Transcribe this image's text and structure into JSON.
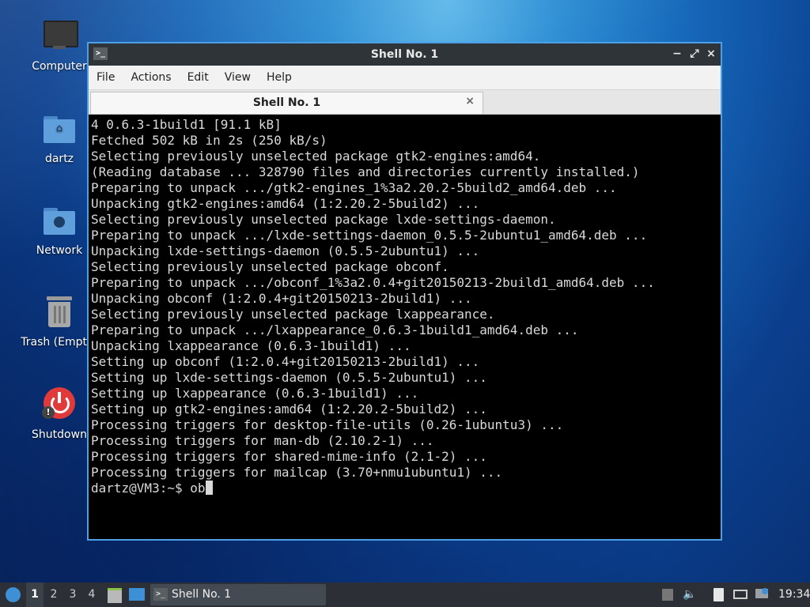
{
  "desktop": {
    "icons": [
      {
        "label": "Computer",
        "icon": "computer-icon"
      },
      {
        "label": "dartz",
        "icon": "home-folder-icon"
      },
      {
        "label": "Network",
        "icon": "network-folder-icon"
      },
      {
        "label": "Trash (Empty)",
        "icon": "trash-icon"
      },
      {
        "label": "Shutdown",
        "icon": "shutdown-icon"
      }
    ]
  },
  "window": {
    "title": "Shell No. 1",
    "menu": [
      "File",
      "Actions",
      "Edit",
      "View",
      "Help"
    ],
    "tab_label": "Shell No. 1",
    "tab_close": "×",
    "controls": {
      "minimize": "−",
      "maximize": "⤢",
      "close": "×"
    }
  },
  "terminal": {
    "lines": [
      "4 0.6.3-1build1 [91.1 kB]",
      "Fetched 502 kB in 2s (250 kB/s)",
      "Selecting previously unselected package gtk2-engines:amd64.",
      "(Reading database ... 328790 files and directories currently installed.)",
      "Preparing to unpack .../gtk2-engines_1%3a2.20.2-5build2_amd64.deb ...",
      "Unpacking gtk2-engines:amd64 (1:2.20.2-5build2) ...",
      "Selecting previously unselected package lxde-settings-daemon.",
      "Preparing to unpack .../lxde-settings-daemon_0.5.5-2ubuntu1_amd64.deb ...",
      "Unpacking lxde-settings-daemon (0.5.5-2ubuntu1) ...",
      "Selecting previously unselected package obconf.",
      "Preparing to unpack .../obconf_1%3a2.0.4+git20150213-2build1_amd64.deb ...",
      "Unpacking obconf (1:2.0.4+git20150213-2build1) ...",
      "Selecting previously unselected package lxappearance.",
      "Preparing to unpack .../lxappearance_0.6.3-1build1_amd64.deb ...",
      "Unpacking lxappearance (0.6.3-1build1) ...",
      "Setting up obconf (1:2.0.4+git20150213-2build1) ...",
      "Setting up lxde-settings-daemon (0.5.5-2ubuntu1) ...",
      "Setting up lxappearance (0.6.3-1build1) ...",
      "Setting up gtk2-engines:amd64 (1:2.20.2-5build2) ...",
      "Processing triggers for desktop-file-utils (0.26-1ubuntu3) ...",
      "Processing triggers for man-db (2.10.2-1) ...",
      "Processing triggers for shared-mime-info (2.1-2) ...",
      "Processing triggers for mailcap (3.70+nmu1ubuntu1) ..."
    ],
    "prompt": "dartz@VM3:~$ ",
    "input": "ob"
  },
  "taskbar": {
    "workspaces": [
      "1",
      "2",
      "3",
      "4"
    ],
    "active_workspace": "1",
    "task_label": "Shell No. 1",
    "clock": "19:34"
  },
  "colors": {
    "window_border": "#4d9fe6",
    "titlebar": "#2f3439",
    "terminal_bg": "#000000",
    "terminal_fg": "#d9d9d9",
    "taskbar": "#2c3036"
  }
}
